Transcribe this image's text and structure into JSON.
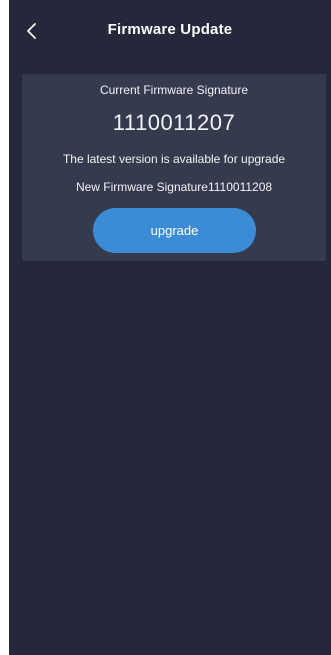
{
  "header": {
    "title": "Firmware Update",
    "back_icon": "chevron-left-icon"
  },
  "firmware": {
    "current_label": "Current Firmware Signature",
    "current_signature": "1110011207",
    "status_message": "The latest version is available for upgrade",
    "new_signature_text": "New Firmware Signature1110011208"
  },
  "actions": {
    "upgrade_label": "upgrade"
  },
  "colors": {
    "background": "#25283a",
    "card": "#353a4d",
    "accent": "#3b8bd6"
  }
}
